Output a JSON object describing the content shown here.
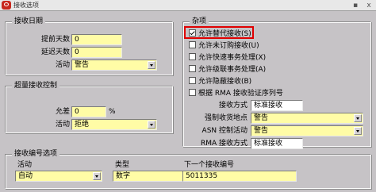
{
  "window": {
    "title": "接收选项",
    "close_glyph": "x"
  },
  "receipt_date": {
    "legend": "接收日期",
    "days_early_label": "提前天数",
    "days_early_value": "0",
    "days_late_label": "延迟天数",
    "days_late_value": "0",
    "action_label": "活动",
    "action_value": "警告"
  },
  "over_receipt": {
    "legend": "超量接收控制",
    "tolerance_label": "允差",
    "tolerance_value": "0",
    "percent": "%",
    "action_label": "活动",
    "action_value": "拒绝"
  },
  "receipt_number": {
    "legend": "接收编号选项",
    "entry_label": "活动",
    "entry_value": "自动",
    "type_label": "类型",
    "type_value": "数字",
    "next_label": "下一个接收编号",
    "next_value": "5011335"
  },
  "misc": {
    "legend": "杂项",
    "checkboxes": [
      {
        "label": "允许替代接收(S)",
        "checked": true
      },
      {
        "label": "允许未订购接收(U)",
        "checked": false
      },
      {
        "label": "允许快速事务处理(X)",
        "checked": false
      },
      {
        "label": "允许级联事务处理(A)",
        "checked": false
      },
      {
        "label": "允许隐蔽接收(B)",
        "checked": false
      },
      {
        "label": "根据 RMA 接收验证序列号",
        "checked": false
      }
    ],
    "routing_label": "接收方式",
    "routing_value": "标准接收",
    "enforce_ship_to_label": "强制收货地点",
    "enforce_ship_to_value": "警告",
    "asn_control_label": "ASN 控制活动",
    "asn_control_value": "警告",
    "rma_routing_label": "RMA 接收方式",
    "rma_routing_value": "标准接收"
  },
  "colors": {
    "required_field": "#fffca6",
    "window_bg": "#c6c3c6",
    "highlight": "#e00000"
  }
}
